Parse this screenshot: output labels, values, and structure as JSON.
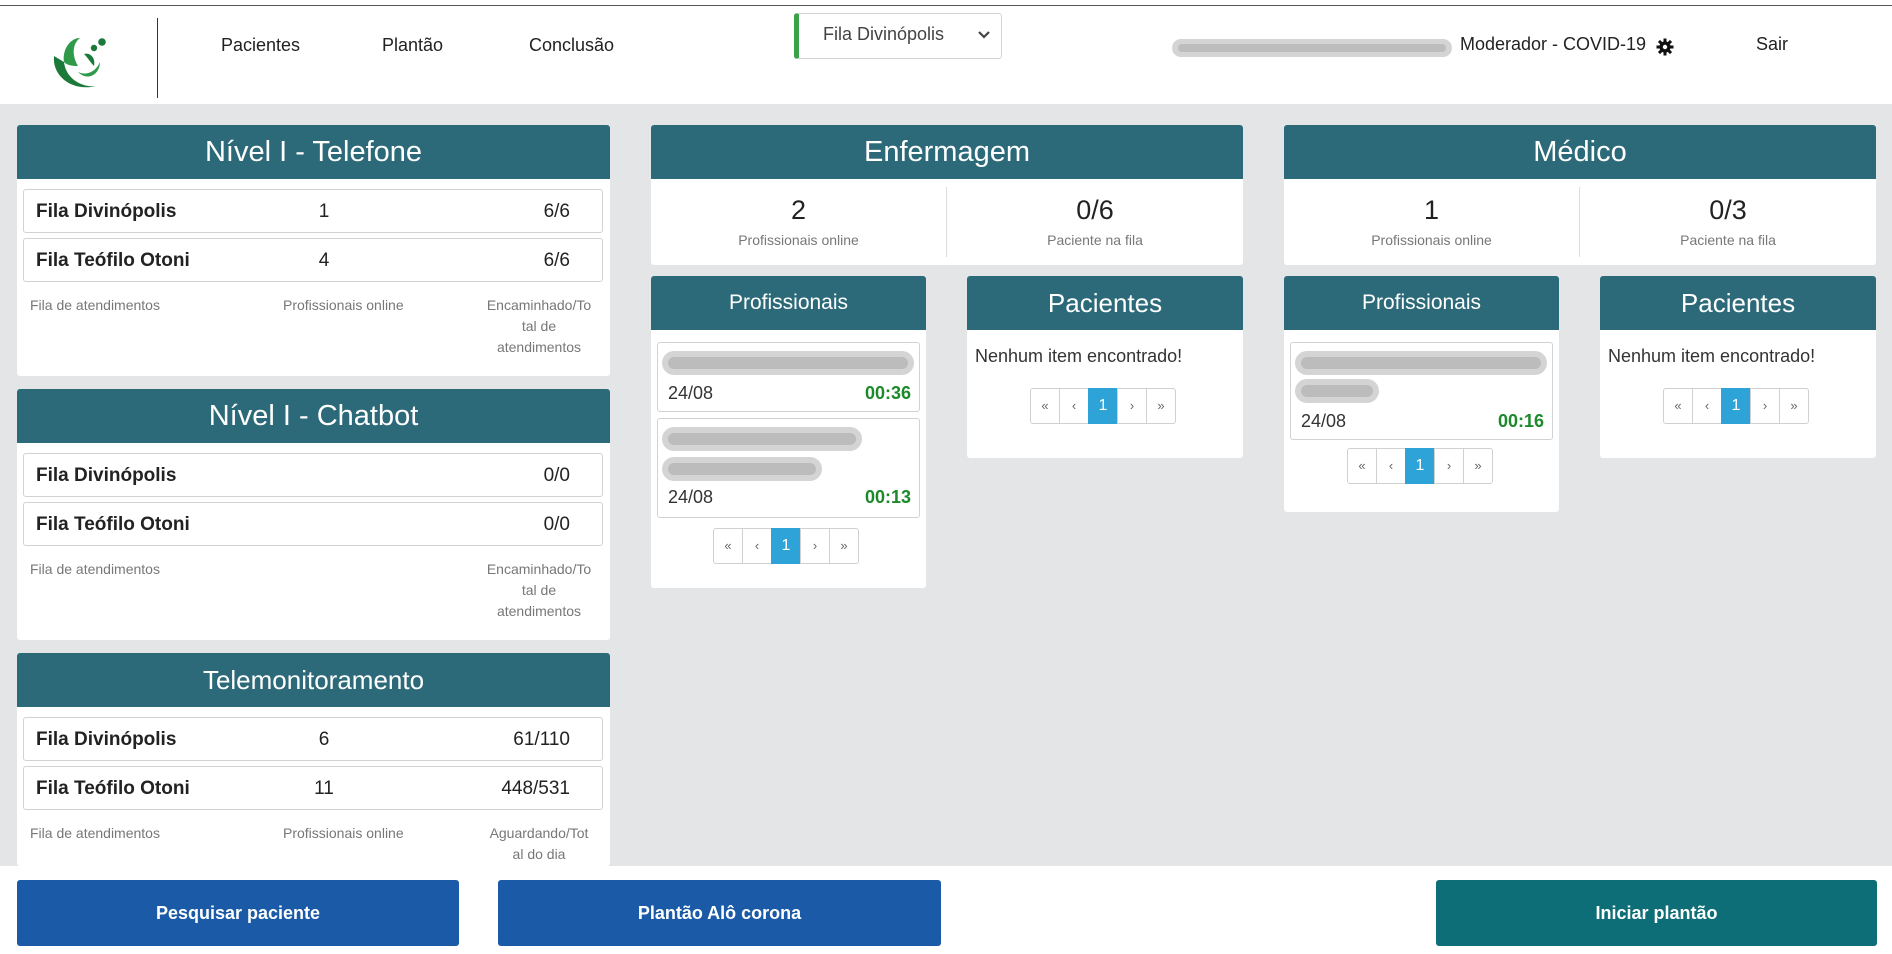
{
  "header": {
    "nav": [
      "Pacientes",
      "Plantão",
      "Conclusão"
    ],
    "queue_select": "Fila Divinópolis",
    "role": "Moderador - COVID-19",
    "logout": "Sair"
  },
  "nivel_telefone": {
    "title": "Nível I - Telefone",
    "rows": [
      {
        "name": "Fila Divinópolis",
        "online": "1",
        "value": "6/6"
      },
      {
        "name": "Fila Teófilo Otoni",
        "online": "4",
        "value": "6/6"
      }
    ],
    "col_queue": "Fila de atendimentos",
    "col_online": "Profissionais online",
    "col_value": [
      "Encaminhado/To",
      "tal de",
      "atendimentos"
    ]
  },
  "nivel_chatbot": {
    "title": "Nível I - Chatbot",
    "rows": [
      {
        "name": "Fila Divinópolis",
        "value": "0/0"
      },
      {
        "name": "Fila Teófilo Otoni",
        "value": "0/0"
      }
    ],
    "col_queue": "Fila de atendimentos",
    "col_value": [
      "Encaminhado/To",
      "tal de",
      "atendimentos"
    ]
  },
  "telemonitoramento": {
    "title": "Telemonitoramento",
    "rows": [
      {
        "name": "Fila Divinópolis",
        "online": "6",
        "value": "61/110"
      },
      {
        "name": "Fila Teófilo Otoni",
        "online": "11",
        "value": "448/531"
      }
    ],
    "col_queue": "Fila de atendimentos",
    "col_online": "Profissionais online",
    "col_value": [
      "Aguardando/Tot",
      "al do dia"
    ]
  },
  "enfermagem": {
    "title": "Enfermagem",
    "online_count": "2",
    "online_label": "Profissionais online",
    "queue_count": "0/6",
    "queue_label": "Paciente na fila",
    "professionals_title": "Profissionais",
    "professionals": [
      {
        "date": "24/08",
        "time": "00:36"
      },
      {
        "date": "24/08",
        "time": "00:13"
      }
    ],
    "patients_title": "Pacientes",
    "patients_empty": "Nenhum item encontrado!"
  },
  "medico": {
    "title": "Médico",
    "online_count": "1",
    "online_label": "Profissionais online",
    "queue_count": "0/3",
    "queue_label": "Paciente na fila",
    "professionals_title": "Profissionais",
    "professionals": [
      {
        "date": "24/08",
        "time": "00:16"
      }
    ],
    "patients_title": "Pacientes",
    "patients_empty": "Nenhum item encontrado!"
  },
  "pagination": {
    "first": "«",
    "prev": "‹",
    "page": "1",
    "next": "›",
    "last": "»"
  },
  "buttons": {
    "search_patient": "Pesquisar paciente",
    "plantao_alo": "Plantão Alô corona",
    "start_shift": "Iniciar plantão"
  },
  "colors": {
    "card_header": "#2d6a79",
    "button_blue": "#1a5aa6",
    "button_teal": "#0e6e77",
    "time_green": "#1c8a2a",
    "page_active": "#2ea3d7",
    "select_accent": "#3aa34a"
  },
  "icons": [
    "app-logo-icon",
    "chevron-down-icon",
    "gear-icon"
  ]
}
